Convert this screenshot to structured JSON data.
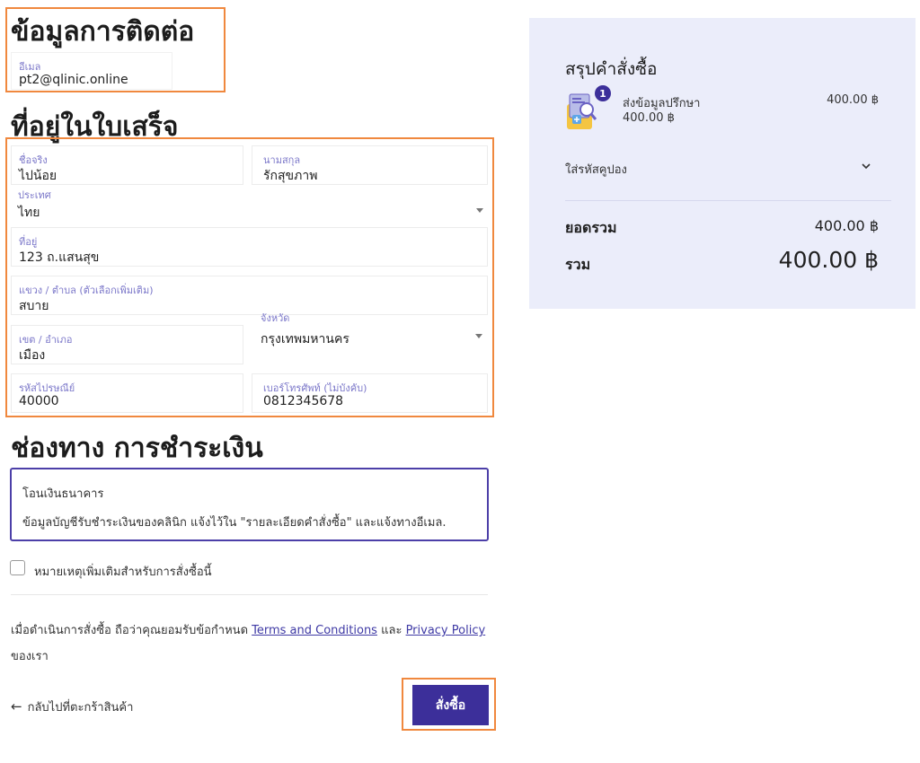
{
  "contact": {
    "title": "ข้อมูลการติดต่อ",
    "email_label": "อีเมล",
    "email_value": "pt2@qlinic.online"
  },
  "address": {
    "title": "ที่อยู่ในใบเสร็จ",
    "first_name_label": "ชื่อจริง",
    "first_name_value": "ไปน้อย",
    "last_name_label": "นามสกุล",
    "last_name_value": "รักสุขภาพ",
    "country_label": "ประเทศ",
    "country_value": "ไทย",
    "address_label": "ที่อยู่",
    "address_value": "123 ถ.แสนสุข",
    "subdistrict_label": "แขวง / ตำบล (ตัวเลือกเพิ่มเติม)",
    "subdistrict_value": "สบาย",
    "district_label": "เขต / อำเภอ",
    "district_value": "เมือง",
    "province_label": "จังหวัด",
    "province_value": "กรุงเทพมหานคร",
    "postcode_label": "รหัสไปรษณีย์",
    "postcode_value": "40000",
    "phone_label": "เบอร์โทรศัพท์ (ไม่บังคับ)",
    "phone_value": "0812345678"
  },
  "payment": {
    "title": "ช่องทาง การชำระเงิน",
    "method_name": "โอนเงินธนาคาร",
    "method_desc": "ข้อมูลบัญชีรับชำระเงินของคลินิก แจ้งไว้ใน \"รายละเอียดคำสั่งซื้อ\" และแจ้งทางอีเมล.",
    "note_checkbox_label": "หมายเหตุเพิ่มเติมสำหรับการสั่งซื้อนี้"
  },
  "terms": {
    "prefix": "เมื่อดำเนินการสั่งซื้อ ถือว่าคุณยอมรับข้อกำหนด ",
    "terms_link": "Terms and Conditions",
    "and": " และ ",
    "privacy_link": "Privacy Policy",
    "suffix": "ของเรา"
  },
  "footer": {
    "back_link": "กลับไปที่ตะกร้าสินค้า",
    "order_button": "สั่งซื้อ"
  },
  "summary": {
    "title": "สรุปคำสั่งซื้อ",
    "item_qty": "1",
    "item_name": "ส่งข้อมูลปรึกษา",
    "item_unit_price": "400.00 ฿",
    "item_total": "400.00 ฿",
    "coupon_label": "ใส่รหัสคูปอง",
    "subtotal_label": "ยอดรวม",
    "subtotal_value": "400.00 ฿",
    "total_label": "รวม",
    "total_value": "400.00 ฿"
  },
  "colors": {
    "accent": "#3c2f9a",
    "highlight": "#f0883e",
    "summary_bg": "#ebedfa"
  }
}
